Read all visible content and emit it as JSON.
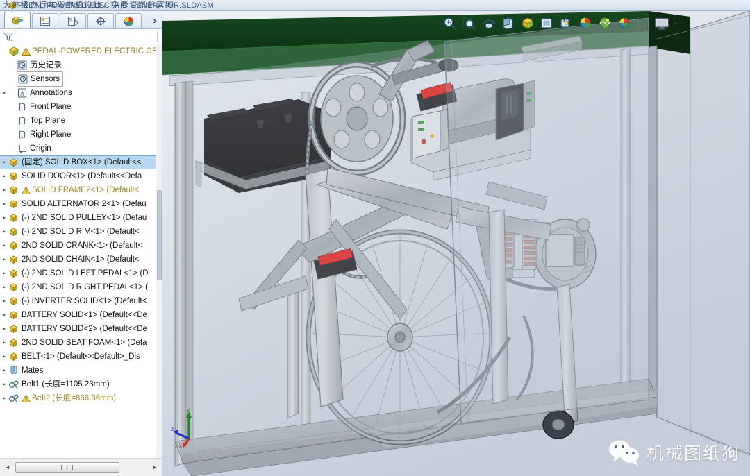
{
  "window": {
    "title": "PEDAL-POWERED ELECTRIC GENERATOR.SLDASM",
    "title_overlay_cn": "大神级自行车发电机设计，免费资料分享图",
    "app_icon": "solidworks-assembly-icon"
  },
  "left_panel": {
    "tabs": [
      {
        "name": "feature-manager-design-tree",
        "icon": "assembly-tree-icon",
        "active": true
      },
      {
        "name": "property-manager",
        "icon": "property-list-icon",
        "active": false
      },
      {
        "name": "configuration-manager",
        "icon": "configuration-icon",
        "active": false
      },
      {
        "name": "dimxpert-manager",
        "icon": "dimxpert-icon",
        "active": false
      },
      {
        "name": "display-manager",
        "icon": "appearance-sphere-icon",
        "active": false
      }
    ],
    "expand_label": "›",
    "filter": {
      "icon": "filter-funnel-icon",
      "value": "",
      "placeholder": ""
    },
    "scroll": {
      "left_arrow": "◄",
      "right_arrow": "►",
      "thumb_grip": "❙❙❙"
    }
  },
  "tree": {
    "items": [
      {
        "label": "PEDAL-POWERED ELECTRIC GENE",
        "icon": "assembly-icon",
        "indent": 0,
        "twisty": "",
        "warn": true,
        "style": "root",
        "selected": false
      },
      {
        "label": "历史记录",
        "icon": "history-icon",
        "indent": 1,
        "twisty": "",
        "warn": false,
        "style": "",
        "selected": false
      },
      {
        "label": "Sensors",
        "icon": "sensor-icon",
        "indent": 1,
        "twisty": "",
        "warn": false,
        "style": "boxed",
        "selected": false
      },
      {
        "label": "Annotations",
        "icon": "annotations-icon",
        "indent": 1,
        "twisty": "▸",
        "warn": false,
        "style": "",
        "selected": false
      },
      {
        "label": "Front Plane",
        "icon": "plane-icon",
        "indent": 1,
        "twisty": "",
        "warn": false,
        "style": "",
        "selected": false
      },
      {
        "label": "Top Plane",
        "icon": "plane-icon",
        "indent": 1,
        "twisty": "",
        "warn": false,
        "style": "",
        "selected": false
      },
      {
        "label": "Right Plane",
        "icon": "plane-icon",
        "indent": 1,
        "twisty": "",
        "warn": false,
        "style": "",
        "selected": false
      },
      {
        "label": "Origin",
        "icon": "origin-icon",
        "indent": 1,
        "twisty": "",
        "warn": false,
        "style": "",
        "selected": false
      },
      {
        "label": "(固定) SOLID BOX<1> (Default<<",
        "icon": "component-icon",
        "indent": 0,
        "twisty": "▸",
        "warn": false,
        "style": "",
        "selected": true
      },
      {
        "label": "SOLID DOOR<1> (Default<<Defa",
        "icon": "component-icon",
        "indent": 0,
        "twisty": "▸",
        "warn": false,
        "style": "",
        "selected": false
      },
      {
        "label": "SOLID FRAME2<1> (Default<",
        "icon": "component-icon",
        "indent": 0,
        "twisty": "▸",
        "warn": true,
        "style": "warn",
        "selected": false
      },
      {
        "label": "SOLID ALTERNATOR 2<1> (Defau",
        "icon": "component-icon",
        "indent": 0,
        "twisty": "▸",
        "warn": false,
        "style": "",
        "selected": false
      },
      {
        "label": "(-) 2ND SOLID PULLEY<1> (Defau",
        "icon": "component-icon",
        "indent": 0,
        "twisty": "▸",
        "warn": false,
        "style": "",
        "selected": false
      },
      {
        "label": "(-) 2ND SOLID RIM<1> (Default<",
        "icon": "component-icon",
        "indent": 0,
        "twisty": "▸",
        "warn": false,
        "style": "",
        "selected": false
      },
      {
        "label": "2ND SOLID CRANK<1> (Default<",
        "icon": "component-icon",
        "indent": 0,
        "twisty": "▸",
        "warn": false,
        "style": "",
        "selected": false
      },
      {
        "label": "2ND SOLID CHAIN<1> (Default<",
        "icon": "component-icon",
        "indent": 0,
        "twisty": "▸",
        "warn": false,
        "style": "",
        "selected": false
      },
      {
        "label": "(-) 2ND SOLID LEFT PEDAL<1> (D",
        "icon": "component-icon",
        "indent": 0,
        "twisty": "▸",
        "warn": false,
        "style": "",
        "selected": false
      },
      {
        "label": "(-) 2ND SOLID RIGHT PEDAL<1> (",
        "icon": "component-icon",
        "indent": 0,
        "twisty": "▸",
        "warn": false,
        "style": "",
        "selected": false
      },
      {
        "label": "(-) INVERTER SOLID<1> (Default<",
        "icon": "component-icon",
        "indent": 0,
        "twisty": "▸",
        "warn": false,
        "style": "",
        "selected": false
      },
      {
        "label": "BATTERY SOLID<1> (Default<<De",
        "icon": "component-icon",
        "indent": 0,
        "twisty": "▸",
        "warn": false,
        "style": "",
        "selected": false
      },
      {
        "label": "BATTERY SOLID<2> (Default<<De",
        "icon": "component-icon",
        "indent": 0,
        "twisty": "▸",
        "warn": false,
        "style": "",
        "selected": false
      },
      {
        "label": "2ND SOLID SEAT FOAM<1> (Defa",
        "icon": "component-icon",
        "indent": 0,
        "twisty": "▸",
        "warn": false,
        "style": "",
        "selected": false
      },
      {
        "label": "BELT<1> (Default<<Default>_Dis",
        "icon": "component-icon",
        "indent": 0,
        "twisty": "▸",
        "warn": false,
        "style": "",
        "selected": false
      },
      {
        "label": "Mates",
        "icon": "mates-icon",
        "indent": 0,
        "twisty": "▸",
        "warn": false,
        "style": "",
        "selected": false
      },
      {
        "label": "Belt1 (长度=1105.23mm)",
        "icon": "belt-icon",
        "indent": 0,
        "twisty": "▸",
        "warn": false,
        "style": "",
        "selected": false
      },
      {
        "label": "Belt2 (长度=866.36mm)",
        "icon": "belt-icon",
        "indent": 0,
        "twisty": "▸",
        "warn": true,
        "style": "warn",
        "selected": false
      }
    ]
  },
  "command_bar": {
    "buttons": [
      {
        "name": "zoom-to-fit-button",
        "icon": "zoom-fit-icon"
      },
      {
        "name": "zoom-to-area-button",
        "icon": "zoom-area-icon"
      },
      {
        "name": "rotate-view-button",
        "icon": "rotate-view-icon"
      },
      {
        "name": "section-view-button",
        "icon": "section-view-icon"
      },
      {
        "name": "view-orientation-button",
        "icon": "view-orientation-icon"
      },
      {
        "name": "display-style-button",
        "icon": "display-style-icon"
      },
      {
        "name": "hide-show-items-button",
        "icon": "hide-show-icon"
      },
      {
        "name": "edit-appearance-button",
        "icon": "appearance-sphere-icon"
      },
      {
        "name": "apply-scene-button",
        "icon": "scene-icon"
      },
      {
        "name": "view-settings-button",
        "icon": "view-settings-icon"
      }
    ],
    "display_style": {
      "name": "display-style-dropdown",
      "icon": "monitor-icon",
      "caret": "▾"
    }
  },
  "viewport": {
    "triad": {
      "x_label": "x",
      "y_label": "y",
      "z_label": "z",
      "x_color": "#cc2222",
      "y_color": "#1f8b1f",
      "z_color": "#2233bb"
    },
    "model_colors": {
      "roof_green": "#14431b",
      "frame_gray": "#a8adb2",
      "battery_black": "#0b0b0d",
      "reflector_red": "#e01b1b",
      "glass_tint": "#c8d0da",
      "background_top": "#e9edf2",
      "background_bottom": "#c9d1dc"
    }
  },
  "watermark": {
    "logo": "wechat-icon",
    "text": "机械图纸狗"
  }
}
